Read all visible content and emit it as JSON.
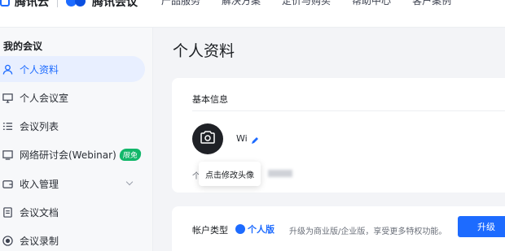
{
  "topbar": {
    "brand_left": "腾讯云",
    "brand_right": "腾讯会议",
    "nav": [
      "产品服务",
      "解决方案",
      "定价与购买",
      "帮助中心",
      "客户案例"
    ]
  },
  "sidebar": {
    "section_title": "我的会议",
    "items": [
      {
        "label": "个人资料",
        "icon": "user-icon"
      },
      {
        "label": "个人会议室",
        "icon": "meeting-room-icon"
      },
      {
        "label": "会议列表",
        "icon": "list-icon"
      },
      {
        "label": "网络研讨会(Webinar)",
        "icon": "monitor-icon",
        "badge": "限免"
      },
      {
        "label": "收入管理",
        "icon": "wallet-icon"
      },
      {
        "label": "会议文档",
        "icon": "document-icon"
      },
      {
        "label": "会议录制",
        "icon": "record-icon"
      }
    ]
  },
  "main": {
    "page_title": "个人资料",
    "basic_info": {
      "section_title": "基本信息",
      "username": "Wi",
      "masked_prefix": "个",
      "avatar_tooltip": "点击修改头像"
    },
    "account": {
      "label": "帐户类型",
      "type": "个人版",
      "upgrade_hint": "升级为商业版/企业版，享受更多特权功能。",
      "upgrade_button": "升级"
    }
  },
  "colors": {
    "accent": "#1d6bff",
    "badge": "#12b76a"
  }
}
